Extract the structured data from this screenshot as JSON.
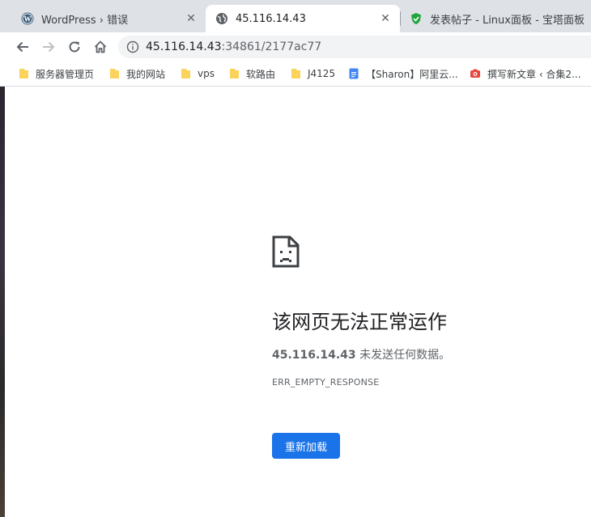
{
  "tabs": [
    {
      "title": "WordPress › 错误",
      "icon": "wordpress-icon",
      "active": false
    },
    {
      "title": "45.116.14.43",
      "icon": "globe-icon",
      "active": true
    },
    {
      "title": "发表帖子 - Linux面板 - 宝塔面板",
      "icon": "bt-shield-icon",
      "active": false
    }
  ],
  "toolbar": {
    "url_host": "45.116.14.43",
    "url_rest": ":34861/2177ac77"
  },
  "bookmarks": [
    {
      "label": "服务器管理页",
      "icon": "folder-icon"
    },
    {
      "label": "我的网站",
      "icon": "folder-icon"
    },
    {
      "label": "vps",
      "icon": "folder-icon"
    },
    {
      "label": "软路由",
      "icon": "folder-icon"
    },
    {
      "label": "J4125",
      "icon": "folder-icon"
    },
    {
      "label": "【Sharon】阿里云...",
      "icon": "doc-icon"
    },
    {
      "label": "撰写新文章 ‹ 合集2...",
      "icon": "camera-icon"
    }
  ],
  "error": {
    "title": "该网页无法正常运作",
    "host": "45.116.14.43",
    "message": " 未发送任何数据。",
    "code": "ERR_EMPTY_RESPONSE",
    "reload_label": "重新加载"
  },
  "colors": {
    "tabstrip": "#dee1e6",
    "omnibox": "#f1f3f4",
    "folder": "#fbd35c",
    "button": "#1a73e8"
  }
}
